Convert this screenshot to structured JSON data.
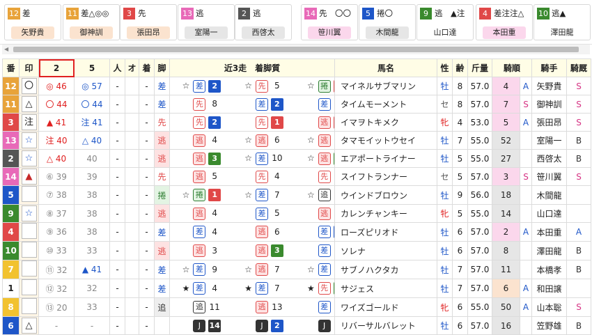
{
  "topcards": [
    {
      "num": "12",
      "mark": "差",
      "name": "矢野貴",
      "color": "#e8a33a",
      "bg": "#fbe3cf"
    },
    {
      "num": "11",
      "mark": "差△◎◎",
      "name": "御神訓",
      "color": "#e8a33a",
      "bg": "#fbe3cf"
    },
    {
      "num": "3",
      "mark": "先",
      "name": "張田昂",
      "color": "#e04848",
      "bg": "#fbe3cf"
    },
    {
      "num": "13",
      "mark": "逃",
      "name": "室陽一",
      "color": "#e86ab8",
      "bg": "#e6e6e6"
    },
    {
      "num": "2",
      "mark": "逃",
      "name": "西啓太",
      "color": "#555555",
      "bg": "#e6e6e6"
    },
    {
      "num": "14",
      "mark": "先　〇〇",
      "name": "笹川翼",
      "color": "#e86ab8",
      "bg": "#fbd7ec"
    },
    {
      "num": "5",
      "mark": "捲〇",
      "name": "木間龍",
      "color": "#1e56c8",
      "bg": "#e6e6e6"
    },
    {
      "num": "9",
      "mark": "逃　▲注",
      "name": "山口達",
      "color": "#3a8a2e",
      "bg": "#ffffff"
    },
    {
      "num": "4",
      "mark": "差注注△",
      "name": "本田重",
      "color": "#e04848",
      "bg": "#fbd7ec"
    },
    {
      "num": "10",
      "mark": "逃▲",
      "name": "澤田龍",
      "color": "#3a8a2e",
      "bg": "#ffffff"
    }
  ],
  "headers": {
    "ban": "番",
    "mark": "印",
    "p2": "2",
    "p5": "5",
    "hito": "人",
    "o": "オ",
    "chaku": "着",
    "ashi": "脚",
    "kinsou": "近3走　着脚質",
    "uma": "馬名",
    "sex": "性",
    "age": "齢",
    "kin": "斤量",
    "kijun": "騎順",
    "kishu": "騎手",
    "kyusha": "騎厩"
  },
  "rows": [
    {
      "ban": "12",
      "bc": "#e8a33a",
      "mark": "〇",
      "mc": "#222",
      "p2m": "◎",
      "p2v": "46",
      "p2c": "c2",
      "p5m": "◎",
      "p5v": "57",
      "p5c": "c5",
      "hito": "-",
      "chaku": "-",
      "ashi": "差",
      "ac": "#1e56c8",
      "abg": "#fff",
      "r": [
        [
          "☆",
          "差",
          "2",
          "#1e56c8"
        ],
        [
          "☆",
          "先",
          "5",
          ""
        ],
        [
          "☆",
          "捲",
          "1",
          "#e04848"
        ]
      ],
      "uma": "マイネルサブマリン",
      "sex": "牡",
      "sc": "sexm",
      "age": "8",
      "kin": "57.0",
      "kj": "4",
      "kjbg": "#fbd7ec",
      "kjm": "A",
      "kjc": "jca",
      "kishu": "矢野貴",
      "ky": "S",
      "kyc": "jcs"
    },
    {
      "ban": "11",
      "bc": "#e8a33a",
      "mark": "△",
      "mc": "#222",
      "p2m": "〇",
      "p2v": "44",
      "p2c": "c2",
      "p5m": "〇",
      "p5v": "44",
      "p5c": "c5",
      "hito": "-",
      "chaku": "-",
      "ashi": "差",
      "ac": "#1e56c8",
      "abg": "#fff",
      "r": [
        [
          "",
          "先",
          "8",
          ""
        ],
        [
          "",
          "差",
          "2",
          "#1e56c8"
        ],
        [
          "",
          "差",
          "11",
          ""
        ]
      ],
      "uma": "タイムモーメント",
      "sex": "セ",
      "sc": "sexs",
      "age": "8",
      "kin": "57.0",
      "kj": "7",
      "kjbg": "#fbd7ec",
      "kjm": "S",
      "kjc": "jcs",
      "kishu": "御神訓",
      "ky": "S",
      "kyc": "jcs"
    },
    {
      "ban": "3",
      "bc": "#e04848",
      "mark": "注",
      "mc": "#222",
      "p2m": "▲",
      "p2v": "41",
      "p2c": "c2",
      "p5m": "注",
      "p5v": "41",
      "p5c": "c5",
      "hito": "-",
      "chaku": "-",
      "ashi": "先",
      "ac": "#e04848",
      "abg": "#fff",
      "r": [
        [
          "",
          "先",
          "2",
          "#1e56c8"
        ],
        [
          "",
          "先",
          "1",
          "#e04848"
        ],
        [
          "",
          "逃",
          "1",
          "#e04848"
        ]
      ],
      "uma": "イマヲトキメク",
      "sex": "牝",
      "sc": "sexf",
      "age": "4",
      "kin": "53.0",
      "kj": "5",
      "kjbg": "#fbd7ec",
      "kjm": "A",
      "kjc": "jca",
      "kishu": "張田昂",
      "ky": "S",
      "kyc": "jcs"
    },
    {
      "ban": "13",
      "bc": "#e86ab8",
      "mark": "☆",
      "mc": "#1e56c8",
      "p2m": "注",
      "p2v": "40",
      "p2c": "c2",
      "p5m": "△",
      "p5v": "40",
      "p5c": "c5",
      "hito": "-",
      "chaku": "-",
      "ashi": "逃",
      "ac": "#e04848",
      "abg": "#fde2e2",
      "r": [
        [
          "",
          "逃",
          "4",
          ""
        ],
        [
          "☆",
          "逃",
          "6",
          ""
        ],
        [
          "☆",
          "逃",
          "4",
          ""
        ]
      ],
      "uma": "タマモイットウセイ",
      "sex": "牡",
      "sc": "sexm",
      "age": "7",
      "kin": "55.0",
      "kj": "52",
      "kjbg": "#e6e6e6",
      "kjm": "",
      "kjc": "jca",
      "kishu": "室陽一",
      "ky": "B",
      "kyc": "jcb"
    },
    {
      "ban": "2",
      "bc": "#555555",
      "mark": "☆",
      "mc": "#1e56c8",
      "p2m": "△",
      "p2v": "40",
      "p2c": "c2",
      "p5m": "",
      "p5v": "40",
      "p5c": "cg",
      "hito": "-",
      "chaku": "-",
      "ashi": "逃",
      "ac": "#e04848",
      "abg": "#fde2e2",
      "r": [
        [
          "",
          "逃",
          "3",
          "#3a8a2e"
        ],
        [
          "☆",
          "差",
          "10",
          ""
        ],
        [
          "☆",
          "逃",
          "3",
          "#3a8a2e"
        ]
      ],
      "uma": "エアポートライナー",
      "sex": "牡",
      "sc": "sexm",
      "age": "5",
      "kin": "55.0",
      "kj": "27",
      "kjbg": "#e6e6e6",
      "kjm": "",
      "kjc": "jca",
      "kishu": "西啓太",
      "ky": "B",
      "kyc": "jcb"
    },
    {
      "ban": "14",
      "bc": "#e86ab8",
      "mark": "▲",
      "mc": "#c62828",
      "p2m": "⑥",
      "p2v": "39",
      "p2c": "cg",
      "p5m": "",
      "p5v": "39",
      "p5c": "cg",
      "hito": "-",
      "chaku": "-",
      "ashi": "先",
      "ac": "#e04848",
      "abg": "#fff",
      "r": [
        [
          "",
          "逃",
          "5",
          ""
        ],
        [
          "",
          "先",
          "4",
          ""
        ],
        [
          "",
          "先",
          "5",
          ""
        ]
      ],
      "uma": "スイフトランナー",
      "sex": "セ",
      "sc": "sexs",
      "age": "5",
      "kin": "57.0",
      "kj": "3",
      "kjbg": "#fbd7ec",
      "kjm": "S",
      "kjc": "jcs",
      "kishu": "笹川翼",
      "ky": "S",
      "kyc": "jcs"
    },
    {
      "ban": "5",
      "bc": "#1e56c8",
      "mark": "",
      "mc": "#222",
      "p2m": "⑦",
      "p2v": "38",
      "p2c": "cg",
      "p5m": "",
      "p5v": "38",
      "p5c": "cg",
      "hito": "-",
      "chaku": "-",
      "ashi": "捲",
      "ac": "#2e7d32",
      "abg": "#e3f4e3",
      "r": [
        [
          "☆",
          "捲",
          "1",
          "#e04848"
        ],
        [
          "☆",
          "差",
          "7",
          ""
        ],
        [
          "☆",
          "追",
          "6",
          ""
        ]
      ],
      "uma": "ウインドブロウン",
      "sex": "牡",
      "sc": "sexm",
      "age": "9",
      "kin": "56.0",
      "kj": "18",
      "kjbg": "#e6e6e6",
      "kjm": "",
      "kjc": "jca",
      "kishu": "木間龍",
      "ky": "",
      "kyc": "jcb"
    },
    {
      "ban": "9",
      "bc": "#3a8a2e",
      "mark": "☆",
      "mc": "#1e56c8",
      "p2m": "⑧",
      "p2v": "37",
      "p2c": "cg",
      "p5m": "",
      "p5v": "38",
      "p5c": "cg",
      "hito": "-",
      "chaku": "-",
      "ashi": "逃",
      "ac": "#e04848",
      "abg": "#fde2e2",
      "r": [
        [
          "",
          "逃",
          "4",
          ""
        ],
        [
          "",
          "差",
          "5",
          ""
        ],
        [
          "",
          "逃",
          "6",
          ""
        ]
      ],
      "uma": "カレンチャンキー",
      "sex": "牝",
      "sc": "sexf",
      "age": "5",
      "kin": "55.0",
      "kj": "14",
      "kjbg": "#e6e6e6",
      "kjm": "",
      "kjc": "jca",
      "kishu": "山口達",
      "ky": "",
      "kyc": "jcb"
    },
    {
      "ban": "4",
      "bc": "#e04848",
      "mark": "",
      "mc": "#222",
      "p2m": "⑨",
      "p2v": "36",
      "p2c": "cg",
      "p5m": "",
      "p5v": "38",
      "p5c": "cg",
      "hito": "-",
      "chaku": "-",
      "ashi": "差",
      "ac": "#1e56c8",
      "abg": "#fff",
      "r": [
        [
          "",
          "差",
          "4",
          ""
        ],
        [
          "",
          "逃",
          "6",
          ""
        ],
        [
          "",
          "差",
          "2",
          "#1e56c8"
        ]
      ],
      "uma": "ローズピリオド",
      "sex": "牡",
      "sc": "sexm",
      "age": "6",
      "kin": "57.0",
      "kj": "2",
      "kjbg": "#fbd7ec",
      "kjm": "A",
      "kjc": "jca",
      "kishu": "本田重",
      "ky": "A",
      "kyc": "jca"
    },
    {
      "ban": "10",
      "bc": "#3a8a2e",
      "mark": "",
      "mc": "#222",
      "p2m": "⑩",
      "p2v": "33",
      "p2c": "cg",
      "p5m": "",
      "p5v": "33",
      "p5c": "cg",
      "hito": "-",
      "chaku": "-",
      "ashi": "逃",
      "ac": "#e04848",
      "abg": "#fde2e2",
      "r": [
        [
          "",
          "逃",
          "3",
          ""
        ],
        [
          "",
          "逃",
          "3",
          "#3a8a2e"
        ],
        [
          "",
          "差",
          "12",
          ""
        ]
      ],
      "uma": "ソレナ",
      "sex": "牡",
      "sc": "sexm",
      "age": "6",
      "kin": "57.0",
      "kj": "8",
      "kjbg": "#e6e6e6",
      "kjm": "",
      "kjc": "jca",
      "kishu": "澤田龍",
      "ky": "B",
      "kyc": "jcb"
    },
    {
      "ban": "7",
      "bc": "#f2c230",
      "mark": "",
      "mc": "#222",
      "p2m": "⑪",
      "p2v": "32",
      "p2c": "cg",
      "p5m": "▲",
      "p5v": "41",
      "p5c": "c5",
      "hito": "-",
      "chaku": "-",
      "ashi": "差",
      "ac": "#1e56c8",
      "abg": "#fff",
      "r": [
        [
          "☆",
          "差",
          "9",
          ""
        ],
        [
          "☆",
          "逃",
          "7",
          ""
        ],
        [
          "☆",
          "差",
          "11",
          ""
        ]
      ],
      "uma": "サブノハクタカ",
      "sex": "牡",
      "sc": "sexm",
      "age": "7",
      "kin": "57.0",
      "kj": "11",
      "kjbg": "#e6e6e6",
      "kjm": "",
      "kjc": "jca",
      "kishu": "本橋孝",
      "ky": "B",
      "kyc": "jcb"
    },
    {
      "ban": "1",
      "bc": "#ffffff",
      "mark": "",
      "mc": "#222",
      "p2m": "⑫",
      "p2v": "32",
      "p2c": "cg",
      "p5m": "",
      "p5v": "32",
      "p5c": "cg",
      "hito": "-",
      "chaku": "-",
      "ashi": "差",
      "ac": "#1e56c8",
      "abg": "#fff",
      "r": [
        [
          "★",
          "差",
          "4",
          ""
        ],
        [
          "★",
          "差",
          "7",
          ""
        ],
        [
          "★",
          "先",
          "3",
          "#3a8a2e"
        ]
      ],
      "uma": "サジェス",
      "sex": "牡",
      "sc": "sexm",
      "age": "7",
      "kin": "57.0",
      "kj": "6",
      "kjbg": "#fbe3cf",
      "kjm": "A",
      "kjc": "jca",
      "kishu": "和田譲",
      "ky": "",
      "kyc": "jcb"
    },
    {
      "ban": "8",
      "bc": "#f2c230",
      "mark": "",
      "mc": "#222",
      "p2m": "⑬",
      "p2v": "20",
      "p2c": "cg",
      "p5m": "",
      "p5v": "33",
      "p5c": "cg",
      "hito": "-",
      "chaku": "-",
      "ashi": "追",
      "ac": "#333",
      "abg": "#eeeeee",
      "r": [
        [
          "",
          "追",
          "11",
          ""
        ],
        [
          "",
          "逃",
          "13",
          ""
        ],
        [
          "",
          "差",
          "10",
          ""
        ]
      ],
      "uma": "ワイズゴールド",
      "sex": "牝",
      "sc": "sexf",
      "age": "6",
      "kin": "55.0",
      "kj": "50",
      "kjbg": "#e6e6e6",
      "kjm": "A",
      "kjc": "jca",
      "kishu": "山本聡",
      "ky": "S",
      "kyc": "jcs"
    },
    {
      "ban": "6",
      "bc": "#1e56c8",
      "mark": "△",
      "mc": "#222",
      "p2m": "",
      "p2v": "-",
      "p2c": "cg",
      "p5m": "",
      "p5v": "-",
      "p5c": "cg",
      "hito": "-",
      "chaku": "-",
      "ashi": "",
      "ac": "#333",
      "abg": "#fff",
      "r": [
        [
          "",
          "J",
          "14",
          "#333"
        ],
        [
          "",
          "J",
          "2",
          "#1e56c8"
        ],
        [
          "",
          "J",
          "7",
          ""
        ]
      ],
      "uma": "リバーサルバレット",
      "sex": "牡",
      "sc": "sexm",
      "age": "6",
      "kin": "57.0",
      "kj": "16",
      "kjbg": "#e6e6e6",
      "kjm": "",
      "kjc": "jca",
      "kishu": "笠野雄",
      "ky": "B",
      "kyc": "jcb"
    }
  ]
}
